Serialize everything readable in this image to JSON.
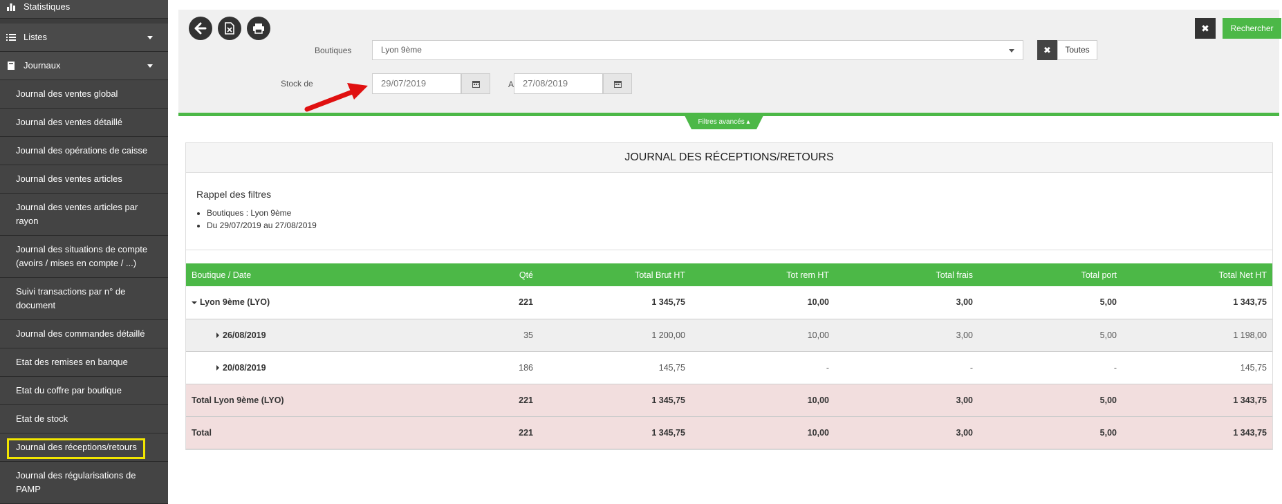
{
  "sidebar": {
    "statistiques": "Statistiques",
    "listes": "Listes",
    "journaux": "Journaux",
    "items": [
      "Journal des ventes global",
      "Journal des ventes détaillé",
      "Journal des opérations de caisse",
      "Journal des ventes articles",
      "Journal des ventes articles par rayon",
      "Journal des situations de compte (avoirs / mises en compte / ...)",
      "Suivi transactions par n° de document",
      "Journal des commandes détaillé",
      "Etat des remises en banque",
      "Etat du coffre par boutique",
      "Etat de stock",
      "Journal des réceptions/retours",
      "Journal des régularisations de PAMP"
    ]
  },
  "filters": {
    "boutiques_label": "Boutiques",
    "boutiques_value": "Lyon 9ème",
    "toutes_label": "Toutes",
    "stock_de_label": "Stock de",
    "date_from": "29/07/2019",
    "au_label": "Au",
    "date_to": "27/08/2019",
    "search_label": "Rechercher",
    "advanced_label": "Filtres avancés ▴",
    "accent_color": "#4cb847"
  },
  "report": {
    "title": "JOURNAL DES RÉCEPTIONS/RETOURS",
    "rappel_title": "Rappel des filtres",
    "rappel_items": [
      "Boutiques : Lyon 9ème",
      "Du 29/07/2019 au 27/08/2019"
    ],
    "columns": [
      "Boutique / Date",
      "Qté",
      "Total Brut HT",
      "Tot rem HT",
      "Total frais",
      "Total port",
      "Total Net HT"
    ],
    "rows": [
      {
        "label": "Lyon 9ème (LYO)",
        "qte": "221",
        "brut": "1 345,75",
        "rem": "10,00",
        "frais": "3,00",
        "port": "5,00",
        "net": "1 343,75"
      },
      {
        "label": "26/08/2019",
        "qte": "35",
        "brut": "1 200,00",
        "rem": "10,00",
        "frais": "3,00",
        "port": "5,00",
        "net": "1 198,00"
      },
      {
        "label": "20/08/2019",
        "qte": "186",
        "brut": "145,75",
        "rem": "-",
        "frais": "-",
        "port": "-",
        "net": "145,75"
      },
      {
        "label": "Total Lyon 9ème (LYO)",
        "qte": "221",
        "brut": "1 345,75",
        "rem": "10,00",
        "frais": "3,00",
        "port": "5,00",
        "net": "1 343,75"
      },
      {
        "label": "Total",
        "qte": "221",
        "brut": "1 345,75",
        "rem": "10,00",
        "frais": "3,00",
        "port": "5,00",
        "net": "1 343,75"
      }
    ]
  }
}
